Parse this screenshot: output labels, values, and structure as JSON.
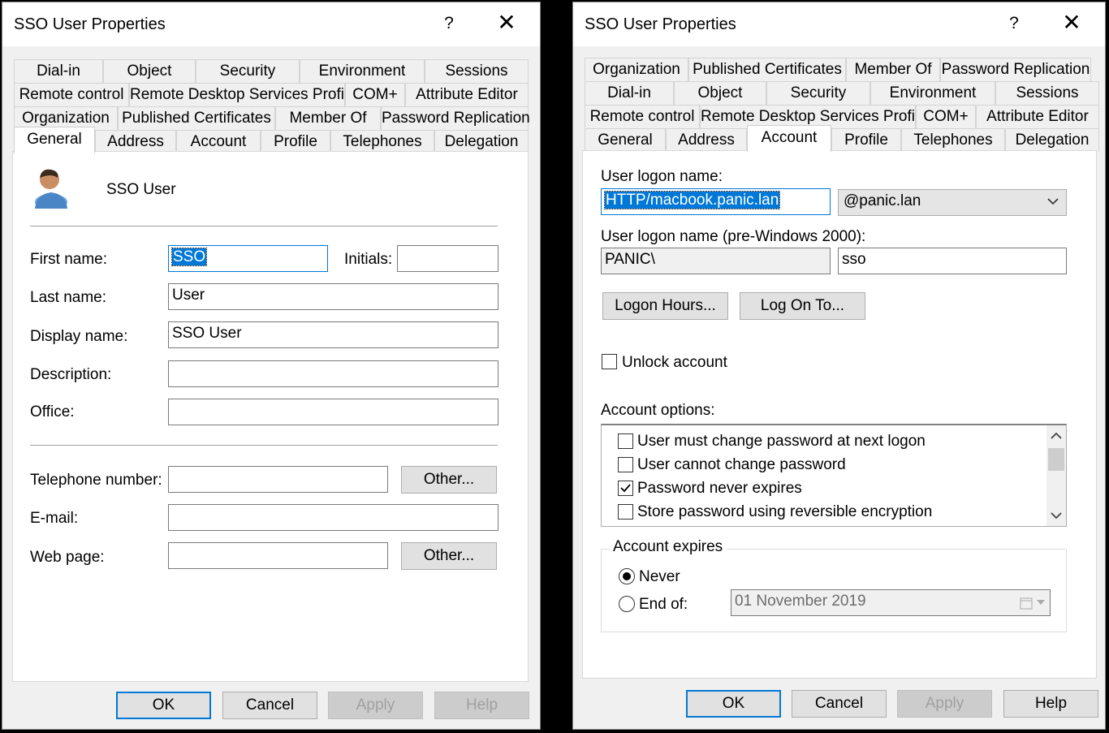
{
  "left": {
    "title": "SSO User Properties",
    "help": "?",
    "close": "✕",
    "tab_rows": [
      [
        "Dial-in",
        "Object",
        "Security",
        "Environment",
        "Sessions"
      ],
      [
        "Remote control",
        "Remote Desktop Services Profile",
        "COM+",
        "Attribute Editor"
      ],
      [
        "Organization",
        "Published Certificates",
        "Member Of",
        "Password Replication"
      ],
      [
        "General",
        "Address",
        "Account",
        "Profile",
        "Telephones",
        "Delegation"
      ]
    ],
    "active_tab": "General",
    "display_user": "SSO User",
    "labels": {
      "first_name": "First name:",
      "initials": "Initials:",
      "last_name": "Last name:",
      "display_name": "Display name:",
      "description": "Description:",
      "office": "Office:",
      "telephone": "Telephone number:",
      "email": "E-mail:",
      "web_page": "Web page:"
    },
    "values": {
      "first_name": "SSO",
      "initials": "",
      "last_name": "User",
      "display_name": "SSO User",
      "description": "",
      "office": "",
      "telephone": "",
      "email": "",
      "web_page": ""
    },
    "other_label": "Other...",
    "buttons": {
      "ok": "OK",
      "cancel": "Cancel",
      "apply": "Apply",
      "help": "Help"
    }
  },
  "right": {
    "title": "SSO User Properties",
    "help": "?",
    "close": "✕",
    "tab_rows": [
      [
        "Organization",
        "Published Certificates",
        "Member Of",
        "Password Replication"
      ],
      [
        "Dial-in",
        "Object",
        "Security",
        "Environment",
        "Sessions"
      ],
      [
        "Remote control",
        "Remote Desktop Services Profile",
        "COM+",
        "Attribute Editor"
      ],
      [
        "General",
        "Address",
        "Account",
        "Profile",
        "Telephones",
        "Delegation"
      ]
    ],
    "active_tab": "Account",
    "logon_name_label": "User logon name:",
    "logon_name_value": "HTTP/macbook.panic.lan",
    "domain_suffix": "@panic.lan",
    "pre2000_label": "User logon name (pre-Windows 2000):",
    "pre2000_domain": "PANIC\\",
    "pre2000_user": "sso",
    "logon_hours": "Logon Hours...",
    "log_on_to": "Log On To...",
    "unlock_account": "Unlock account",
    "account_options_label": "Account options:",
    "account_options": [
      {
        "label": "User must change password at next logon",
        "checked": false
      },
      {
        "label": "User cannot change password",
        "checked": false
      },
      {
        "label": "Password never expires",
        "checked": true
      },
      {
        "label": "Store password using reversible encryption",
        "checked": false
      }
    ],
    "account_expires_label": "Account expires",
    "never_label": "Never",
    "end_of_label": "End of:",
    "expires_selected": "Never",
    "end_date": "01 November 2019",
    "buttons": {
      "ok": "OK",
      "cancel": "Cancel",
      "apply": "Apply",
      "help": "Help"
    }
  }
}
